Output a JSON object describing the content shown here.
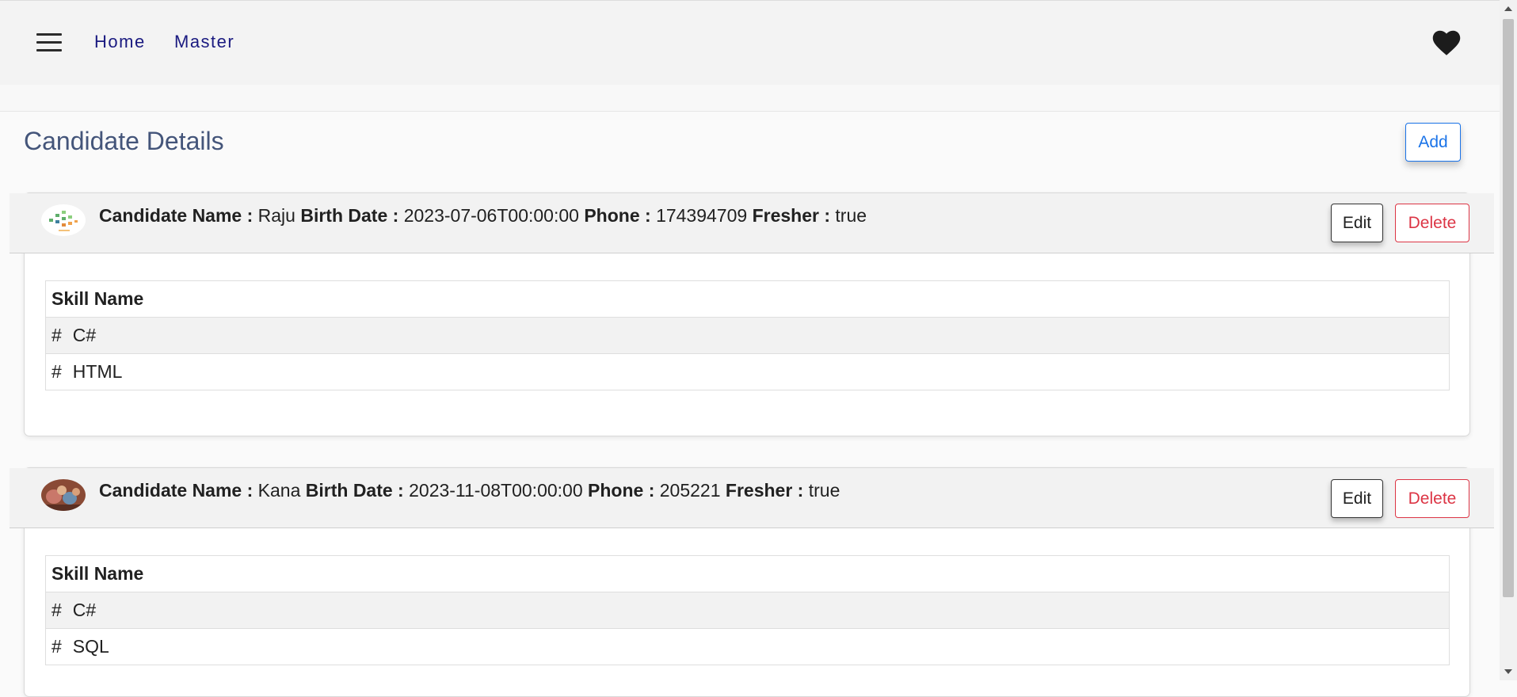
{
  "nav": {
    "links": [
      "Home",
      "Master"
    ]
  },
  "page": {
    "title": "Candidate Details",
    "add_label": "Add"
  },
  "labels": {
    "name": "Candidate Name :",
    "birth": "Birth Date :",
    "phone": "Phone :",
    "fresher": "Fresher :",
    "skill_header": "Skill Name",
    "edit": "Edit",
    "delete": "Delete",
    "hash": "#"
  },
  "candidates": [
    {
      "name": "Raju",
      "birth_date": "2023-07-06T00:00:00",
      "phone": "174394709",
      "fresher": "true",
      "skills": [
        "C#",
        "HTML"
      ]
    },
    {
      "name": "Kana",
      "birth_date": "2023-11-08T00:00:00",
      "phone": "205221",
      "fresher": "true",
      "skills": [
        "C#",
        "SQL"
      ]
    }
  ],
  "colors": {
    "nav_link": "#1a1a80",
    "title": "#44557a",
    "primary": "#1a73e8",
    "danger": "#dc3545"
  }
}
